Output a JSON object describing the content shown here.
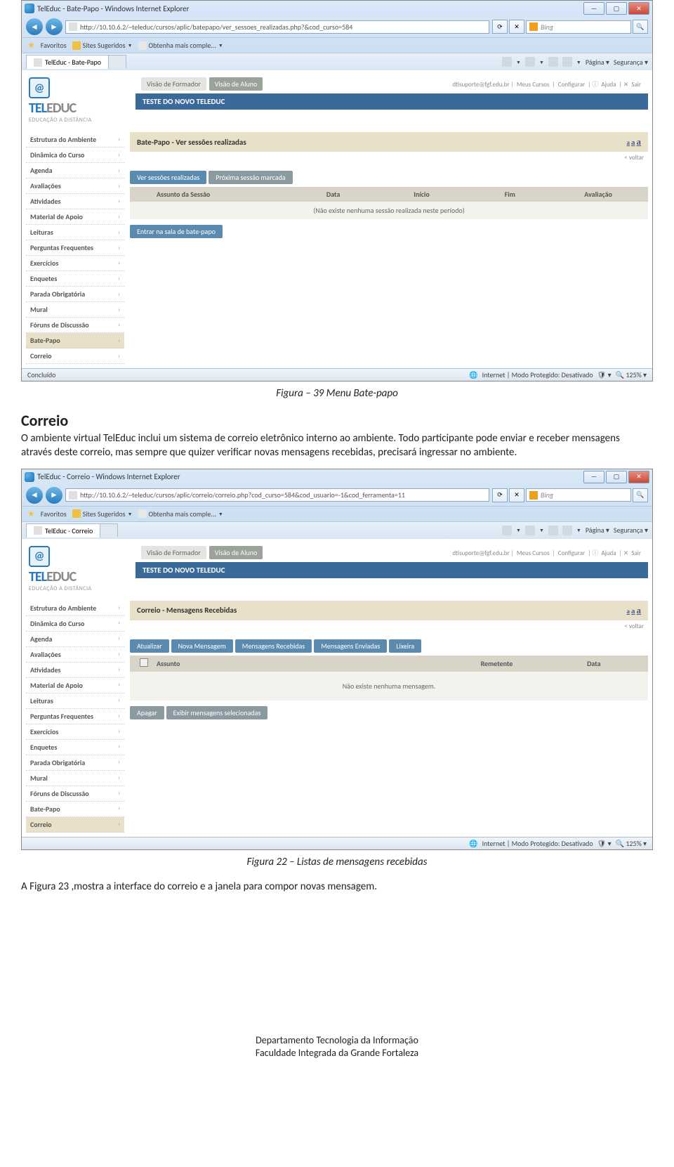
{
  "captions": {
    "fig39": "Figura – 39 Menu Bate-papo",
    "fig22": "Figura 22  – Listas de mensagens recebidas"
  },
  "doc": {
    "heading": "Correio",
    "para": "O ambiente virtual TelEduc inclui um sistema de correio eletrônico interno ao ambiente. Todo participante pode enviar e receber mensagens através deste correio, mas sempre que quizer verificar novas mensagens recebidas, precisará ingressar no ambiente.",
    "para2": "A Figura 23 ,mostra a interface do correio e a janela para compor novas mensagem."
  },
  "footer": {
    "line1": "Departamento Tecnologia da Informação",
    "line2": "Faculdade Integrada da Grande Fortaleza"
  },
  "ie": {
    "title1": "TelEduc - Bate-Papo - Windows Internet Explorer",
    "title2": "TelEduc - Correio - Windows Internet Explorer",
    "url1": "http://10.10.6.2/~teleduc/cursos/aplic/batepapo/ver_sessoes_realizadas.php?&cod_curso=584",
    "url2": "http://10.10.6.2/~teleduc/cursos/aplic/correio/correio.php?cod_curso=584&cod_usuario=-1&cod_ferramenta=11",
    "search": "Bing",
    "favorites": "Favoritos",
    "sites_sugeridos": "Sites Sugeridos",
    "obtenha1": "Obtenha mais comple...",
    "obtenha2": "Obtenha mais comple...",
    "tab1": "TelEduc - Bate-Papo",
    "tab2": "TelEduc - Correio",
    "cmd_pagina": "Página",
    "cmd_seguranca": "Segurança",
    "status_left1": "Concluído",
    "status_left2": "",
    "status_internet": "Internet | Modo Protegido: Desativado",
    "zoom": "125%"
  },
  "teleduc": {
    "logo_brand_tel": "TEL",
    "logo_brand_educ": "EDUC",
    "logo_sub": "EDUCAÇÃO A DISTÂNCIA",
    "vision_formador": "Visão de Formador",
    "vision_aluno": "Visão de Aluno",
    "user_email": "dtisuporte@fgf.edu.br",
    "link_meus_cursos": "Meus Cursos",
    "link_configurar": "Configurar",
    "link_ajuda": "Ajuda",
    "link_sair": "Sair",
    "banner": "TESTE DO NOVO TELEDUC",
    "voltar": "< voltar"
  },
  "sidebar_items": [
    "Estrutura do Ambiente",
    "Dinâmica do Curso",
    "Agenda",
    "Avaliações",
    "Atividades",
    "Material de Apoio",
    "Leituras",
    "Perguntas Frequentes",
    "Exercícios",
    "Enquetes",
    "Parada Obrigatória",
    "Mural",
    "Fóruns de Discussão",
    "Bate-Papo",
    "Correio"
  ],
  "batepapo": {
    "section_title": "Bate-Papo - Ver sessões realizadas",
    "tab_ver": "Ver sessões realizadas",
    "tab_proxima": "Próxima sessão marcada",
    "th_assunto": "Assunto da Sessão",
    "th_data": "Data",
    "th_inicio": "Início",
    "th_fim": "Fim",
    "th_avaliacao": "Avaliação",
    "empty": "(Não existe nenhuma sessão realizada neste período)",
    "btn_entrar": "Entrar na sala de bate-papo"
  },
  "correio": {
    "section_title": "Correio - Mensagens Recebidas",
    "tab_atualizar": "Atualizar",
    "tab_nova": "Nova Mensagem",
    "tab_recebidas": "Mensagens Recebidas",
    "tab_enviadas": "Mensagens Enviadas",
    "tab_lixeira": "Lixeira",
    "th_assunto": "Assunto",
    "th_remetente": "Remetente",
    "th_data": "Data",
    "empty": "Não existe nenhuma mensagem.",
    "btn_apagar": "Apagar",
    "btn_exibir": "Exibir mensagens selecionadas"
  }
}
